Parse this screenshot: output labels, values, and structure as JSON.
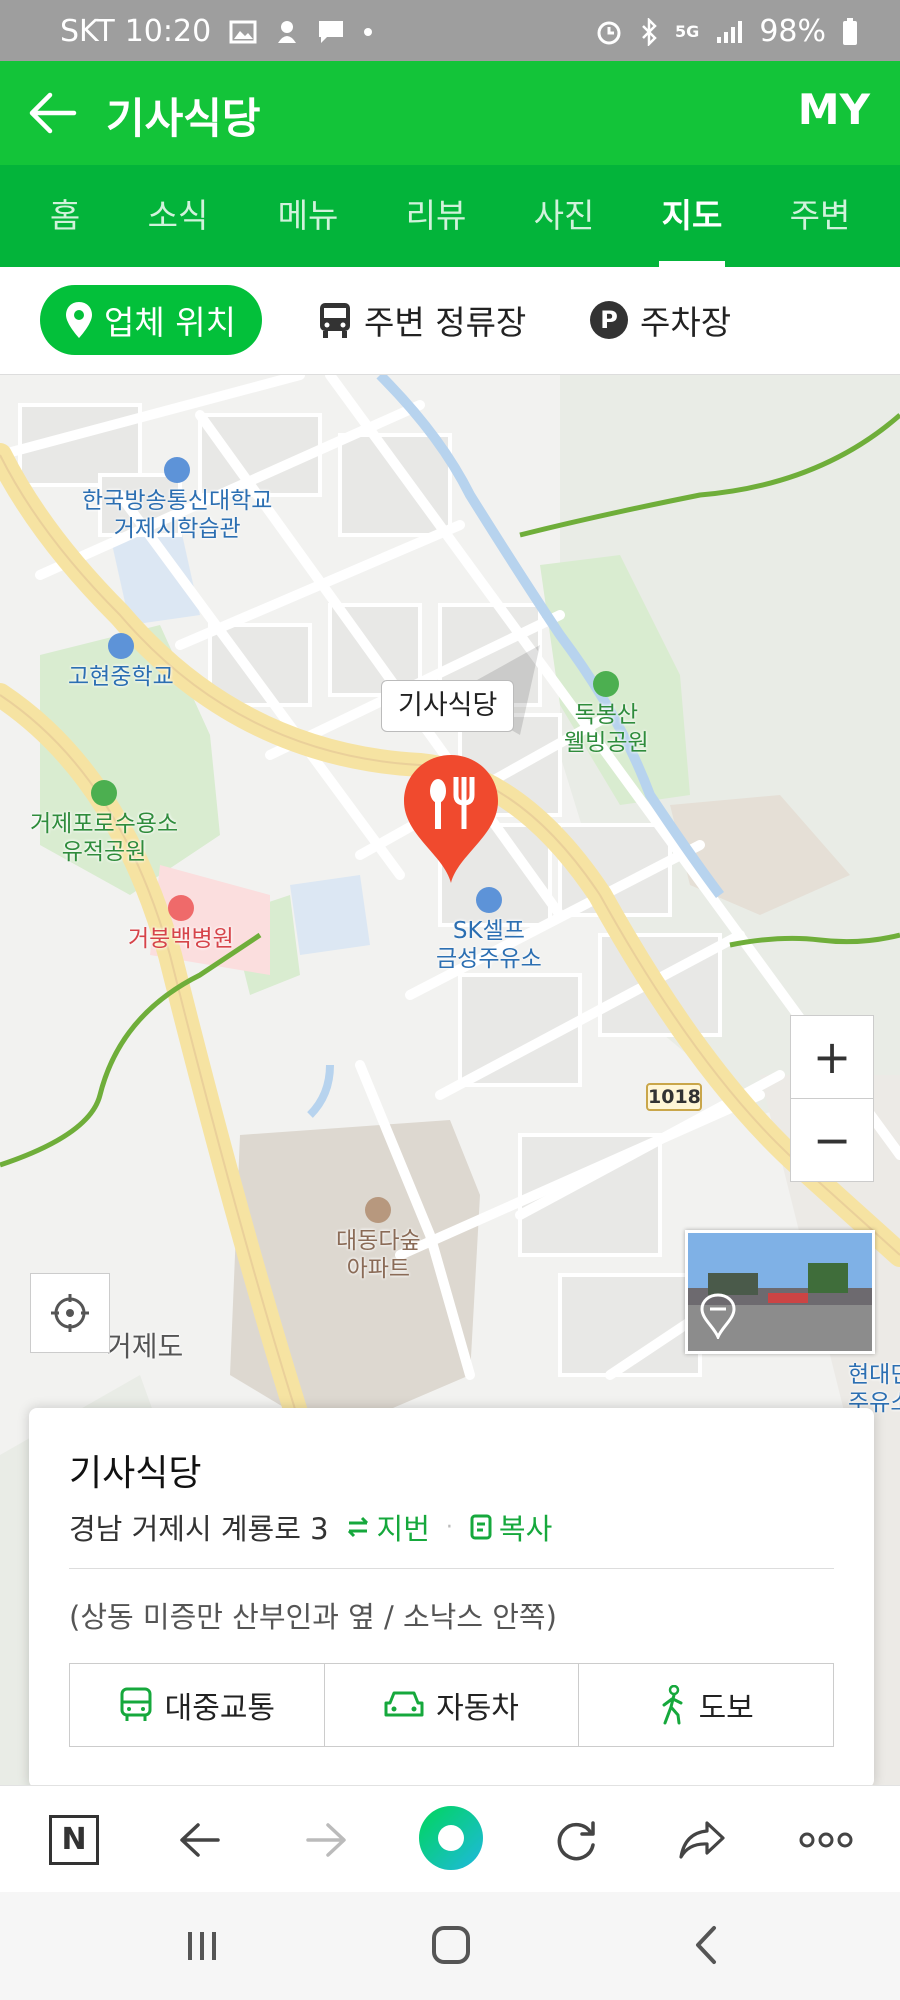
{
  "status_bar": {
    "carrier": "SKT",
    "time": "10:20",
    "network": "5G",
    "battery": "98%"
  },
  "header": {
    "back_icon": "arrow-left-icon",
    "title": "기사식당",
    "my_label": "MY"
  },
  "tabs": [
    {
      "label": "홈"
    },
    {
      "label": "소식"
    },
    {
      "label": "메뉴"
    },
    {
      "label": "리뷰"
    },
    {
      "label": "사진"
    },
    {
      "label": "지도",
      "active": true
    },
    {
      "label": "주변"
    }
  ],
  "segments": {
    "location": "업체 위치",
    "stops": "주변 정류장",
    "parking": "주차장",
    "parking_badge": "P"
  },
  "map": {
    "marker_label": "기사식당",
    "places": {
      "university": "한국방송통신대학교\n거제시학습관",
      "middle_school": "고현중학교",
      "pow_camp": "거제포로수용소\n유적공원",
      "hospital": "거붕백병원",
      "park": "독봉산\n웰빙공원",
      "gas": "SK셀프\n금성주유소",
      "apartment": "대동다숲\n아파트",
      "island": "거제도",
      "right_edge": "현대민들\n주유소"
    },
    "road_number": "1018",
    "zoom_in": "+",
    "zoom_out": "−"
  },
  "place_card": {
    "name": "기사식당",
    "address": "경남 거제시 계룡로 3",
    "jibun_label": "지번",
    "copy_label": "복사",
    "directions_hint": "(상동 미증만 산부인과 옆 / 소낙스 안쪽)",
    "routes": [
      {
        "label": "대중교통",
        "icon": "bus-icon"
      },
      {
        "label": "자동차",
        "icon": "car-icon"
      },
      {
        "label": "도보",
        "icon": "walk-icon"
      }
    ]
  },
  "bottom_nav": {
    "n_label": "N"
  },
  "colors": {
    "brand_green": "#03c03a",
    "header_green": "#13c439",
    "marker_red": "#f04a2e",
    "link_green": "#16a83c"
  }
}
